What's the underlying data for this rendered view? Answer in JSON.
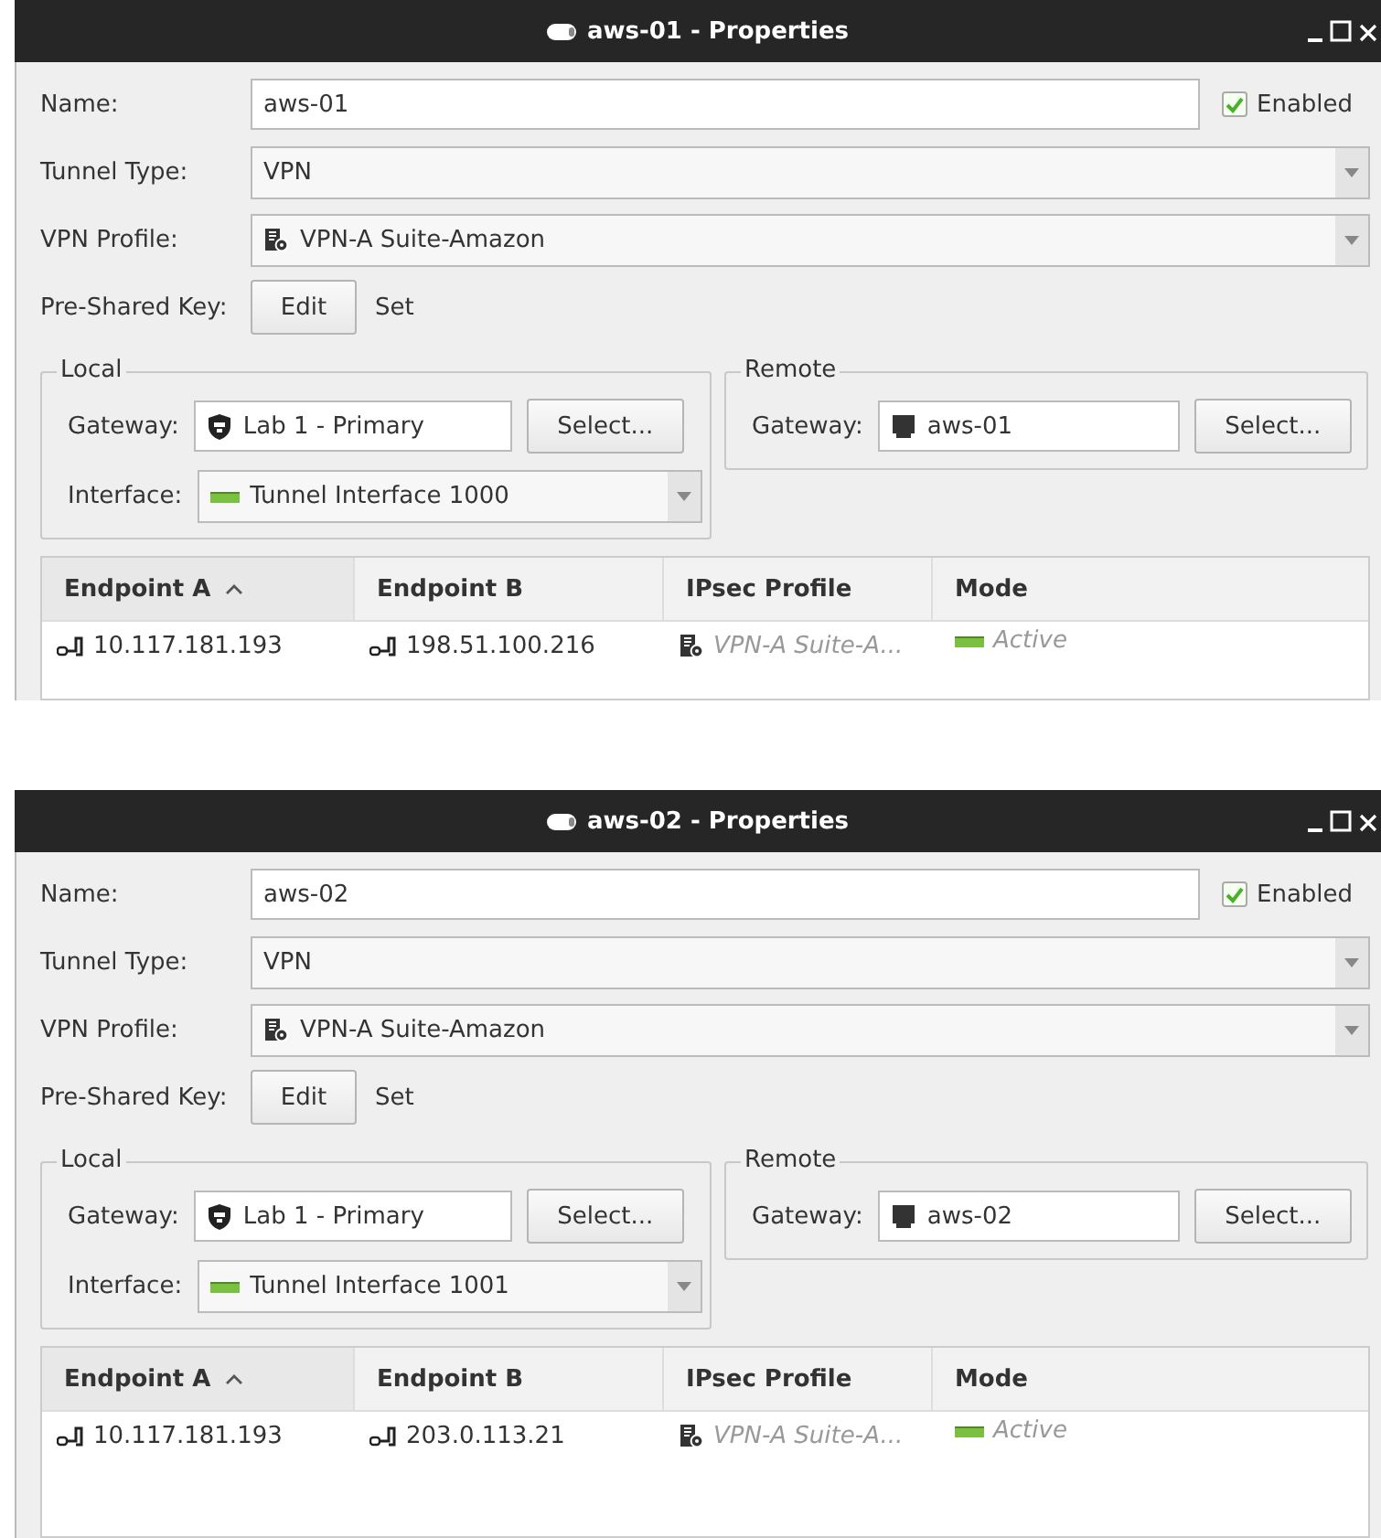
{
  "windows": [
    {
      "title": "aws-01 - Properties",
      "name": {
        "label": "Name:",
        "value": "aws-01"
      },
      "enabled": {
        "label": "Enabled",
        "checked": true
      },
      "tunnel_type": {
        "label": "Tunnel Type:",
        "value": "VPN"
      },
      "vpn_profile": {
        "label": "VPN Profile:",
        "value": "VPN-A Suite-Amazon"
      },
      "pre_shared_key": {
        "label": "Pre-Shared Key:",
        "button": "Edit",
        "status": "Set"
      },
      "local": {
        "title": "Local",
        "gateway_label": "Gateway:",
        "gateway": "Lab 1 - Primary",
        "select_button": "Select...",
        "interface_label": "Interface:",
        "interface": "Tunnel Interface 1000"
      },
      "remote": {
        "title": "Remote",
        "gateway_label": "Gateway:",
        "gateway": "aws-01",
        "select_button": "Select..."
      },
      "table": {
        "columns": [
          {
            "label": "Endpoint A",
            "sorted": true
          },
          {
            "label": "Endpoint B",
            "sorted": false
          },
          {
            "label": "IPsec Profile",
            "sorted": false
          },
          {
            "label": "Mode",
            "sorted": false
          }
        ],
        "rows": [
          {
            "endpoint_a": "10.117.181.193",
            "endpoint_b": "198.51.100.216",
            "ipsec_profile": "VPN-A Suite-A...",
            "mode": "Active"
          }
        ]
      }
    },
    {
      "title": "aws-02 - Properties",
      "name": {
        "label": "Name:",
        "value": "aws-02"
      },
      "enabled": {
        "label": "Enabled",
        "checked": true
      },
      "tunnel_type": {
        "label": "Tunnel Type:",
        "value": "VPN"
      },
      "vpn_profile": {
        "label": "VPN Profile:",
        "value": "VPN-A Suite-Amazon"
      },
      "pre_shared_key": {
        "label": "Pre-Shared Key:",
        "button": "Edit",
        "status": "Set"
      },
      "local": {
        "title": "Local",
        "gateway_label": "Gateway:",
        "gateway": "Lab 1 - Primary",
        "select_button": "Select...",
        "interface_label": "Interface:",
        "interface": "Tunnel Interface 1001"
      },
      "remote": {
        "title": "Remote",
        "gateway_label": "Gateway:",
        "gateway": "aws-02",
        "select_button": "Select..."
      },
      "table": {
        "columns": [
          {
            "label": "Endpoint A",
            "sorted": true
          },
          {
            "label": "Endpoint B",
            "sorted": false
          },
          {
            "label": "IPsec Profile",
            "sorted": false
          },
          {
            "label": "Mode",
            "sorted": false
          }
        ],
        "rows": [
          {
            "endpoint_a": "10.117.181.193",
            "endpoint_b": "203.0.113.21",
            "ipsec_profile": "VPN-A Suite-A...",
            "mode": "Active"
          }
        ]
      }
    }
  ]
}
